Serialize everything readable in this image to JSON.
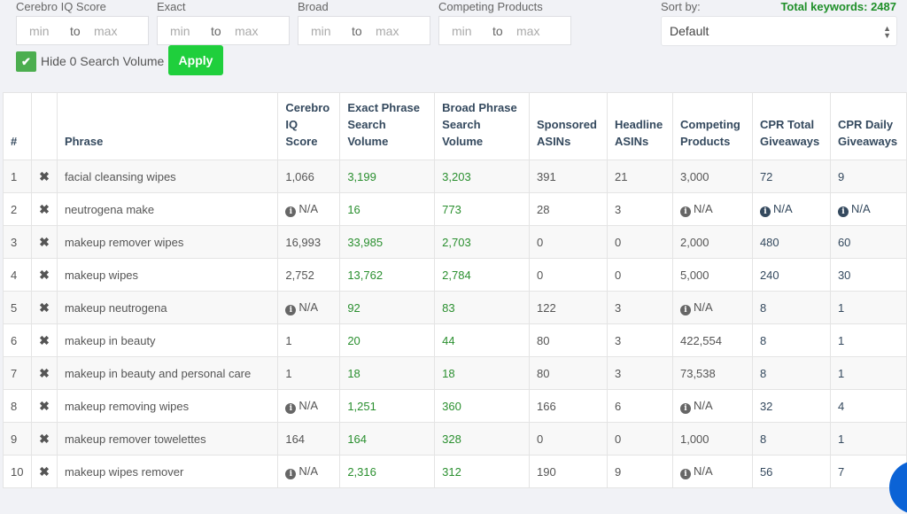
{
  "filters": {
    "groups": [
      {
        "label": "Cerebro IQ Score",
        "min_placeholder": "min",
        "to": "to",
        "max_placeholder": "max"
      },
      {
        "label": "Exact",
        "min_placeholder": "min",
        "to": "to",
        "max_placeholder": "max"
      },
      {
        "label": "Broad",
        "min_placeholder": "min",
        "to": "to",
        "max_placeholder": "max"
      },
      {
        "label": "Competing Products",
        "min_placeholder": "min",
        "to": "to",
        "max_placeholder": "max"
      }
    ],
    "sort_label": "Sort by:",
    "sort_value": "Default",
    "total_keywords": "Total keywords: 2487",
    "hide_zero_label": "Hide 0 Search Volume",
    "hide_zero_checked": true,
    "apply_label": "Apply"
  },
  "colors": {
    "apply_green": "#1fcf3c",
    "checkbox_green": "#4cae4f",
    "total_green": "#1f8f29",
    "volume_green": "#2a8f2f",
    "header_navy": "#34495e",
    "fab_blue": "#0b63d6"
  },
  "table": {
    "headers": [
      "#",
      "",
      "Phrase",
      "Cerebro IQ Score",
      "Exact Phrase Search Volume",
      "Broad Phrase Search Volume",
      "Sponsored ASINs",
      "Headline ASINs",
      "Competing Products",
      "CPR Total Giveaways",
      "CPR Daily Giveaways"
    ],
    "rows": [
      {
        "num": "1",
        "phrase": "facial cleansing wipes",
        "iq": "1,066",
        "exact": "3,199",
        "broad": "3,203",
        "sponsored": "391",
        "headline": "21",
        "competing": "3,000",
        "cpr_total": "72",
        "cpr_daily": "9"
      },
      {
        "num": "2",
        "phrase": "neutrogena make",
        "iq": "N/A",
        "exact": "16",
        "broad": "773",
        "sponsored": "28",
        "headline": "3",
        "competing": "N/A",
        "cpr_total": "N/A",
        "cpr_daily": "N/A"
      },
      {
        "num": "3",
        "phrase": "makeup remover wipes",
        "iq": "16,993",
        "exact": "33,985",
        "broad": "2,703",
        "sponsored": "0",
        "headline": "0",
        "competing": "2,000",
        "cpr_total": "480",
        "cpr_daily": "60"
      },
      {
        "num": "4",
        "phrase": "makeup wipes",
        "iq": "2,752",
        "exact": "13,762",
        "broad": "2,784",
        "sponsored": "0",
        "headline": "0",
        "competing": "5,000",
        "cpr_total": "240",
        "cpr_daily": "30"
      },
      {
        "num": "5",
        "phrase": "makeup neutrogena",
        "iq": "N/A",
        "exact": "92",
        "broad": "83",
        "sponsored": "122",
        "headline": "3",
        "competing": "N/A",
        "cpr_total": "8",
        "cpr_daily": "1"
      },
      {
        "num": "6",
        "phrase": "makeup in beauty",
        "iq": "1",
        "exact": "20",
        "broad": "44",
        "sponsored": "80",
        "headline": "3",
        "competing": "422,554",
        "cpr_total": "8",
        "cpr_daily": "1"
      },
      {
        "num": "7",
        "phrase": "makeup in beauty and personal care",
        "iq": "1",
        "exact": "18",
        "broad": "18",
        "sponsored": "80",
        "headline": "3",
        "competing": "73,538",
        "cpr_total": "8",
        "cpr_daily": "1"
      },
      {
        "num": "8",
        "phrase": "makeup removing wipes",
        "iq": "N/A",
        "exact": "1,251",
        "broad": "360",
        "sponsored": "166",
        "headline": "6",
        "competing": "N/A",
        "cpr_total": "32",
        "cpr_daily": "4"
      },
      {
        "num": "9",
        "phrase": "makeup remover towelettes",
        "iq": "164",
        "exact": "164",
        "broad": "328",
        "sponsored": "0",
        "headline": "0",
        "competing": "1,000",
        "cpr_total": "8",
        "cpr_daily": "1"
      },
      {
        "num": "10",
        "phrase": "makeup wipes remover",
        "iq": "N/A",
        "exact": "2,316",
        "broad": "312",
        "sponsored": "190",
        "headline": "9",
        "competing": "N/A",
        "cpr_total": "56",
        "cpr_daily": "7"
      }
    ]
  },
  "icons": {
    "remove": "✖",
    "info": "i",
    "check": "✔",
    "select_arrows": "▲▼"
  }
}
